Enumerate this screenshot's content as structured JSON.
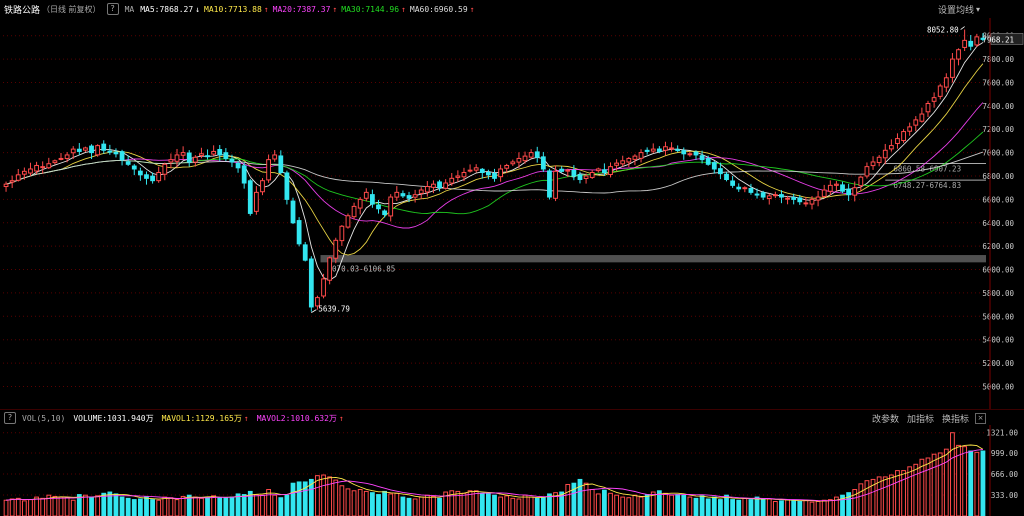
{
  "header": {
    "title": "铁路公路",
    "period": "（日线 前复权）",
    "help": "?",
    "ma_label": "MA",
    "ma5": "MA5:7868.27",
    "ma10": "MA10:7713.88",
    "ma20": "MA20:7387.37",
    "ma30": "MA30:7144.96",
    "ma60": "MA60:6960.59",
    "arrow_down": "↓",
    "arrow_up": "↑",
    "settings": "设置均线",
    "caret": "▾"
  },
  "volume_header": {
    "name": "VOL(5,10)",
    "volume": "VOLUME:1031.940万",
    "mavol1": "MAVOL1:1129.165万",
    "mavol2": "MAVOL2:1010.632万",
    "arrow": "↑",
    "buttons": [
      "改参数",
      "加指标",
      "换指标"
    ],
    "close": "×"
  },
  "colors": {
    "up": "#ff4a4a",
    "down": "#33e6f0",
    "ma5": "#ffffff",
    "ma10": "#ffe94a",
    "ma20": "#ff44ff",
    "ma30": "#22dd22",
    "ma60": "#dddddd",
    "grid": "#5a0000",
    "axis_text": "#cccccc"
  },
  "chart_data": [
    {
      "type": "candlestick",
      "title": "铁路公路",
      "y_ticks": [
        5000,
        5200,
        5400,
        5600,
        5800,
        6000,
        6200,
        6400,
        6600,
        6800,
        7000,
        7200,
        7400,
        7600,
        7800,
        8000
      ],
      "y_tick_labels": [
        "5000.00",
        "5200.00",
        "5400.00",
        "5600.00",
        "5800.00",
        "6000.00",
        "6200.00",
        "6400.00",
        "6600.00",
        "6800.00",
        "7000.00",
        "7200.00",
        "7400.00",
        "7600.00",
        "7800.00",
        "8000.00"
      ],
      "ylim": [
        4850,
        8100
      ],
      "current_price": 7968.21,
      "current_price_label": "7968.21",
      "annotations": [
        {
          "text": "8052.80",
          "value": 8052.8,
          "index": 157
        },
        {
          "text": "5639.79",
          "value": 5639.79,
          "index": 50
        },
        {
          "text": "6070.03-6106.85",
          "low": 6070.03,
          "high": 6106.85
        },
        {
          "text": "6860.58-6907.23",
          "low": 6860.58,
          "high": 6907.23
        },
        {
          "text": "6748.27-6764.83",
          "low": 6748.27,
          "high": 6764.83
        }
      ],
      "closes": [
        6730,
        6760,
        6810,
        6840,
        6860,
        6890,
        6880,
        6905,
        6930,
        6950,
        6980,
        7030,
        7010,
        7040,
        7000,
        7060,
        7020,
        7010,
        6990,
        6940,
        6900,
        6860,
        6810,
        6780,
        6760,
        6830,
        6900,
        6940,
        6980,
        7000,
        6920,
        6960,
        6990,
        6970,
        7010,
        6980,
        6950,
        6920,
        6870,
        6740,
        6480,
        6660,
        6760,
        6940,
        6980,
        6830,
        6600,
        6400,
        6220,
        6080,
        5680,
        5760,
        5920,
        6100,
        6250,
        6370,
        6460,
        6540,
        6600,
        6660,
        6560,
        6520,
        6470,
        6620,
        6660,
        6630,
        6610,
        6640,
        6680,
        6710,
        6730,
        6700,
        6740,
        6780,
        6800,
        6830,
        6850,
        6870,
        6830,
        6810,
        6780,
        6860,
        6890,
        6920,
        6950,
        6970,
        7000,
        6960,
        6860,
        6620,
        6840,
        6840,
        6850,
        6800,
        6770,
        6800,
        6830,
        6860,
        6830,
        6880,
        6910,
        6930,
        6950,
        6970,
        7000,
        7010,
        7030,
        7010,
        7050,
        7040,
        7020,
        6990,
        6990,
        6980,
        6940,
        6900,
        6860,
        6820,
        6770,
        6720,
        6690,
        6700,
        6660,
        6640,
        6620,
        6630,
        6640,
        6620,
        6610,
        6600,
        6580,
        6570,
        6600,
        6620,
        6680,
        6720,
        6730,
        6670,
        6640,
        6700,
        6790,
        6880,
        6920,
        6960,
        7020,
        7060,
        7120,
        7180,
        7220,
        7280,
        7330,
        7420,
        7470,
        7570,
        7640,
        7800,
        7880,
        7960,
        7910,
        7990,
        7968
      ]
    },
    {
      "type": "bar",
      "title": "VOL(5,10)",
      "y_ticks": [
        333,
        666,
        999,
        1321
      ],
      "y_tick_labels": [
        "333.00",
        "666.00",
        "999.00",
        "1321.00"
      ],
      "ylim": [
        0,
        1380
      ],
      "unit": "万",
      "volumes": [
        250,
        270,
        280,
        240,
        260,
        300,
        280,
        330,
        310,
        300,
        290,
        250,
        340,
        330,
        300,
        320,
        360,
        380,
        350,
        300,
        280,
        260,
        270,
        300,
        260,
        250,
        300,
        290,
        260,
        310,
        330,
        300,
        280,
        300,
        320,
        290,
        290,
        300,
        350,
        340,
        390,
        340,
        330,
        420,
        330,
        290,
        330,
        520,
        540,
        540,
        580,
        640,
        650,
        620,
        570,
        480,
        430,
        400,
        420,
        390,
        370,
        340,
        390,
        350,
        360,
        300,
        280,
        270,
        300,
        330,
        310,
        280,
        380,
        400,
        390,
        360,
        400,
        400,
        360,
        350,
        330,
        300,
        320,
        280,
        270,
        330,
        300,
        280,
        300,
        350,
        370,
        380,
        500,
        520,
        580,
        520,
        420,
        350,
        410,
        360,
        330,
        300,
        290,
        330,
        300,
        340,
        380,
        400,
        360,
        330,
        340,
        330,
        300,
        280,
        320,
        270,
        300,
        260,
        330,
        260,
        250,
        280,
        260,
        300,
        260,
        270,
        230,
        240,
        260,
        250,
        230,
        250,
        220,
        230,
        250,
        260,
        300,
        330,
        370,
        420,
        510,
        560,
        580,
        620,
        620,
        650,
        720,
        720,
        780,
        820,
        900,
        920,
        980,
        1000,
        1060,
        1321,
        1120,
        1100,
        1030,
        1010,
        1031
      ]
    }
  ]
}
